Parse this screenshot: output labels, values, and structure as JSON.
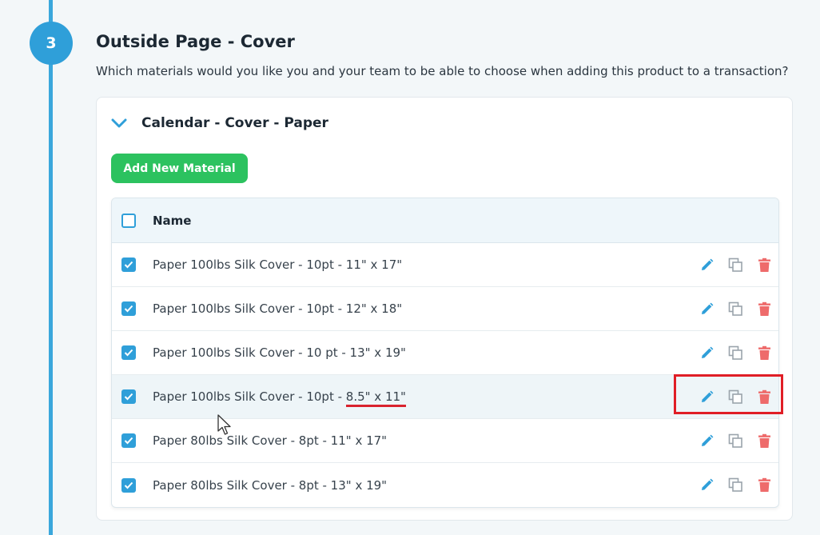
{
  "step": {
    "number": "3"
  },
  "section": {
    "title": "Outside Page - Cover",
    "description": "Which materials would you like you and your team to be able to choose when adding this product to a transaction?"
  },
  "card": {
    "title": "Calendar - Cover - Paper",
    "add_button_label": "Add New Material",
    "table": {
      "header_name": "Name",
      "rows": [
        {
          "label": "Paper 100lbs Silk Cover - 10pt - 11\" x 17\""
        },
        {
          "label": "Paper 100lbs Silk Cover - 10pt - 12\" x 18\""
        },
        {
          "label": "Paper 100lbs Silk Cover - 10 pt - 13\" x 19\""
        },
        {
          "label_prefix": "Paper 100lbs Silk Cover - 10pt - ",
          "label_highlight": "8.5\" x 11\""
        },
        {
          "label": "Paper 80lbs Silk Cover - 8pt - 11\" x 17\""
        },
        {
          "label": "Paper 80lbs Silk Cover - 8pt - 13\" x 19\""
        }
      ]
    }
  },
  "icons": {
    "chevron": "chevron-down-icon",
    "edit": "pencil-icon",
    "copy": "copy-icon",
    "delete": "trash-icon"
  },
  "colors": {
    "accent": "#2f9fd9",
    "add_button": "#2cc25f",
    "delete_icon": "#ee6b6b",
    "annotation": "#e01e26"
  }
}
